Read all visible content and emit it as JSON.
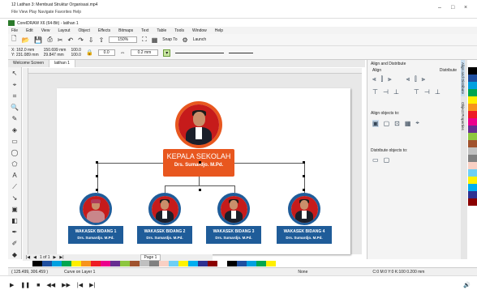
{
  "video_title": "12 Latihan 3: Membuat Struktur Organisasi.mp4",
  "video_menu": "File  View  Play  Navigate  Favorites  Help",
  "app_title": "CorelDRAW X6 (64-Bit) - latihan 1",
  "menu": [
    "File",
    "Edit",
    "View",
    "Layout",
    "Object",
    "Effects",
    "Bitmaps",
    "Text",
    "Table",
    "Tools",
    "Window",
    "Help"
  ],
  "toolbar": {
    "zoom": "150%",
    "snap": "Snap To",
    "launch": "Launch"
  },
  "propbar": {
    "x": "X: 162.0 mm",
    "y": "Y: 231.089 mm",
    "w": "150.699 mm",
    "h": "29.847 mm",
    "sx": "100.0",
    "sy": "100.0",
    "angle": "0.0",
    "outline": "0.2 mm"
  },
  "tabs": [
    "Welcome Screen",
    "latihan 1"
  ],
  "org": {
    "head_title": "KEPALA SEKOLAH",
    "head_name": "Drs. Sumardjo. M.Pd.",
    "subs": [
      {
        "title": "WAKASEK BIDANG 1",
        "name": "Drs. Sumardjo. M.Pd."
      },
      {
        "title": "WAKASEK BIDANG 2",
        "name": "Drs. Sumardjo. M.Pd."
      },
      {
        "title": "WAKASEK BIDANG 3",
        "name": "Drs. Sumardjo. M.Pd."
      },
      {
        "title": "WAKASEK BIDANG 4",
        "name": "Drs. Sumardjo. M.Pd."
      }
    ]
  },
  "docker": {
    "title": "Align and Distribute",
    "align_label": "Align",
    "distribute_label": "Distribute",
    "align_objects_to": "Align objects to:",
    "distribute_objects_to": "Distribute objects to:",
    "side_tabs": [
      "Align and Distribute",
      "Object Properties"
    ]
  },
  "pagebar": {
    "page_info": "1 of 1",
    "page_name": "Page 1"
  },
  "status": {
    "coords": "( 125.499, 306.459 )",
    "layer": "Curve on Layer 1",
    "fill": "None",
    "outline": "C:0 M:0 Y:0 K:100  0.200 mm"
  },
  "colors": {
    "accent": "#e8571f",
    "blue": "#1f5c99",
    "palette": [
      "#ffffff",
      "#000000",
      "#1f4fa0",
      "#00a0e0",
      "#00a650",
      "#ffef00",
      "#f7941d",
      "#ed1c24",
      "#ec008c",
      "#662d91",
      "#8dc63f",
      "#a0522d",
      "#c0c0c0",
      "#808080",
      "#f9d0c4",
      "#6dcff6",
      "#fff200",
      "#00aeef",
      "#2e3192",
      "#8b0000"
    ]
  }
}
